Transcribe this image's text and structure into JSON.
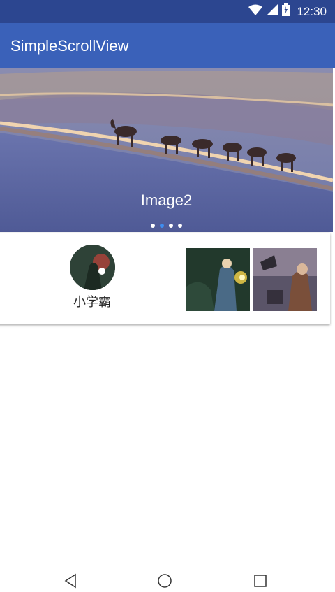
{
  "status_bar": {
    "time": "12:30",
    "icons": [
      "wifi-icon",
      "cell-signal-icon",
      "battery-charging-icon"
    ]
  },
  "app_bar": {
    "title": "SimpleScrollView"
  },
  "banner": {
    "caption": "Image2",
    "page_count": 4,
    "active_index": 1,
    "colors": {
      "sky": "#7f8cb7",
      "sand": "#5a66a4",
      "active_dot": "#3f8ef0"
    }
  },
  "card": {
    "avatar_name": "小学霸",
    "thumbnails": [
      "hero-thumbnail-1",
      "hero-thumbnail-2"
    ]
  },
  "nav_bar": {
    "icons": [
      "back-icon",
      "home-icon",
      "recents-icon"
    ]
  },
  "colors": {
    "status_bar": "#2c4690",
    "app_bar": "#3a61b9"
  }
}
